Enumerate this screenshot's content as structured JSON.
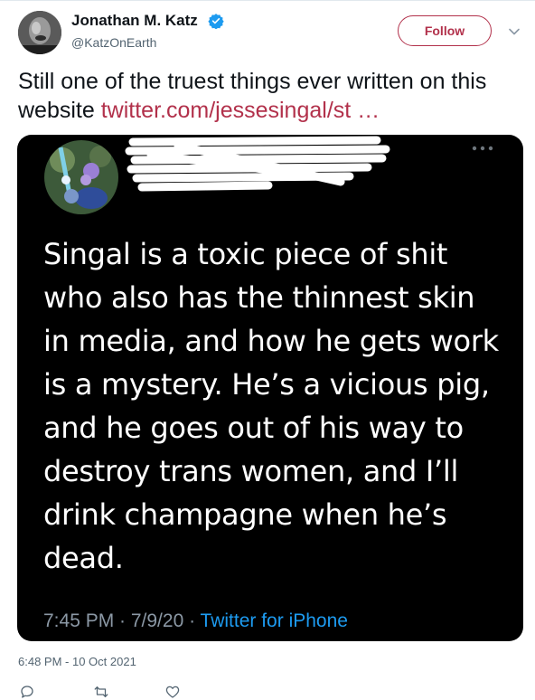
{
  "author": {
    "name": "Jonathan M. Katz",
    "handle": "@KatzOnEarth",
    "verified": true
  },
  "follow_label": "Follow",
  "tweet": {
    "text": "Still one of the truest things ever written on this website ",
    "link": "twitter.com/jessesingal/st …"
  },
  "quoted": {
    "text": "Singal is a toxic piece of shit who also has the thinnest skin in media, and how he gets work is a mystery. He’s a vicious pig, and he goes out of his way to destroy trans women, and I’ll drink champagne when he’s dead.",
    "time": "7:45 PM · 7/9/20 · ",
    "source": "Twitter for iPhone"
  },
  "timestamp": "6:48 PM - 10 Oct 2021",
  "colors": {
    "accent": "#b2314b",
    "verified": "#1d9bf0",
    "quote_background": "#000000",
    "muted": "#536471"
  },
  "icons": [
    "verified-badge-icon",
    "chevron-down-icon",
    "more-dots-icon",
    "reply-icon",
    "retweet-icon",
    "like-icon"
  ]
}
